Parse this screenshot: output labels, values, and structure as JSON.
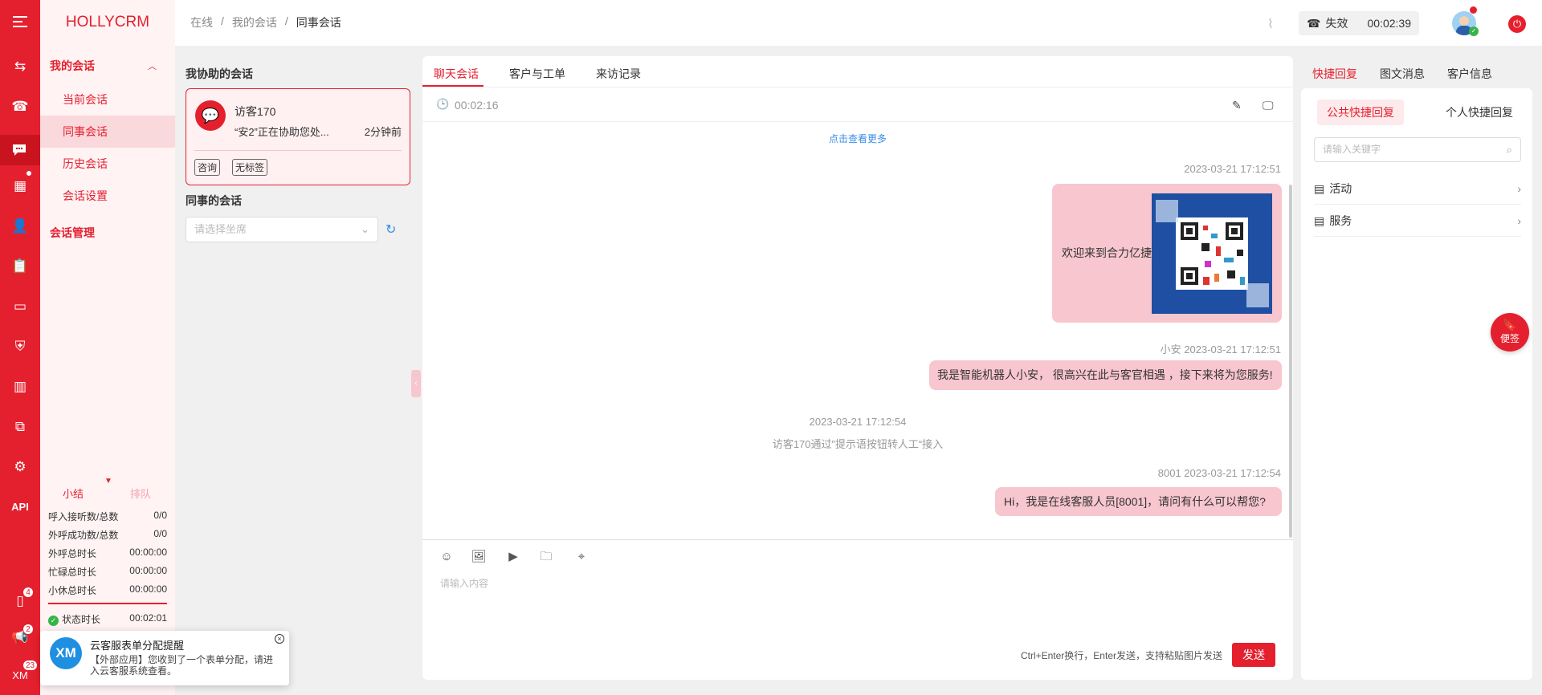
{
  "brand": "HOLLYCRM",
  "breadcrumb": [
    "在线",
    "我的会话",
    "同事会话"
  ],
  "breadcrumb_sep": "/",
  "call_status": {
    "label": "失效",
    "timer": "00:02:39"
  },
  "nav": {
    "group1": "我的会话",
    "items": [
      "当前会话",
      "同事会话",
      "历史会话",
      "会话设置"
    ],
    "group2": "会话管理"
  },
  "rail": {
    "api_label": "API",
    "badge_apps": "4",
    "badge_notice": "2",
    "badge_xm": "23",
    "xm_label": "XM"
  },
  "status_tabs": {
    "active": "小结",
    "inactive": "排队"
  },
  "stats": [
    {
      "label": "呼入接听数/总数",
      "value": "0/0"
    },
    {
      "label": "外呼成功数/总数",
      "value": "0/0"
    },
    {
      "label": "外呼总时长",
      "value": "00:00:00"
    },
    {
      "label": "忙碌总时长",
      "value": "00:00:00"
    },
    {
      "label": "小休总时长",
      "value": "00:00:00"
    }
  ],
  "state_duration": {
    "label": "状态时长",
    "value": "00:02:01"
  },
  "assist": {
    "title": "我协助的会话",
    "card": {
      "name": "访客170",
      "preview": "“安2”正在协助您处...",
      "time": "2分钟前",
      "tags": [
        "咨询",
        "无标签"
      ]
    },
    "colleague_title": "同事的会话",
    "seat_placeholder": "请选择坐席"
  },
  "chat": {
    "tabs": [
      "聊天会话",
      "客户与工单",
      "来访记录"
    ],
    "timer": "00:02:16",
    "load_more": "点击查看更多",
    "messages": [
      {
        "meta": "2023-03-21 17:12:51",
        "text": "欢迎来到合力亿捷"
      },
      {
        "meta": "小安 2023-03-21 17:12:51",
        "text": "我是智能机器人小安， 很高兴在此与客官相遇 ，接下来将为您服务!"
      },
      {
        "meta": "2023-03-21 17:12:54",
        "text": "访客170通过”提示语按钮转人工“接入"
      },
      {
        "meta": "8001 2023-03-21 17:12:54",
        "text": "Hi，我是在线客服人员[8001]，请问有什么可以帮您?"
      }
    ],
    "input_placeholder": "请输入内容",
    "hint": "Ctrl+Enter换行，Enter发送，支持粘贴图片发送",
    "send": "发送"
  },
  "right": {
    "tabs": [
      "快捷回复",
      "图文消息",
      "客户信息"
    ],
    "subtabs": [
      "公共快捷回复",
      "个人快捷回复"
    ],
    "search_placeholder": "请输入关键字",
    "items": [
      "活动",
      "服务"
    ]
  },
  "float_btn": "便签",
  "toast": {
    "logo": "XM",
    "title": "云客服表单分配提醒",
    "body": "【外部应用】您收到了一个表单分配，请进入云客服系统查看。"
  },
  "colors": {
    "accent": "#e5202e",
    "bubble": "#f8c6ce",
    "nav_bg": "#fff3f4"
  }
}
